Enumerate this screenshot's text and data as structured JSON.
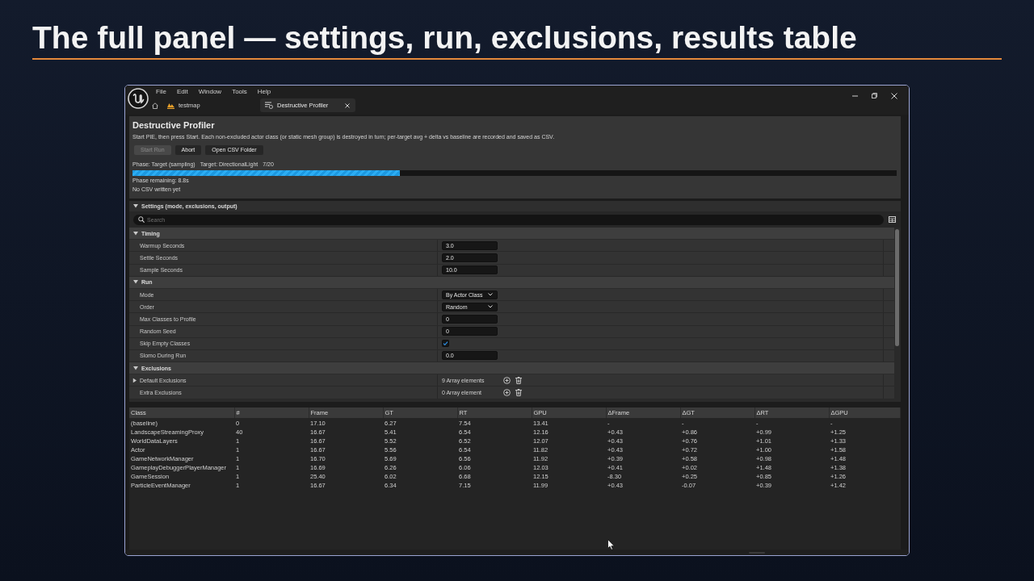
{
  "slide": {
    "title": "The full panel — settings, run, exclusions, results table"
  },
  "window": {
    "menu": [
      "File",
      "Edit",
      "Window",
      "Tools",
      "Help"
    ],
    "level": {
      "label": "testmap"
    },
    "tabs": [
      {
        "label": "Destructive Profiler",
        "selected": true
      }
    ]
  },
  "profiler": {
    "title": "Destructive Profiler",
    "description": "Start PIE, then press Start. Each non-excluded actor class (or static mesh group) is destroyed in turn; per-target avg + delta vs baseline are recorded and saved as CSV.",
    "buttons": [
      {
        "label": "Start Run",
        "disabled": true
      },
      {
        "label": "Abort",
        "disabled": false
      },
      {
        "label": "Open CSV Folder",
        "disabled": false
      }
    ],
    "status": {
      "phase": "Phase: Target (sampling)",
      "target": "Target: DirectionalLight",
      "count": "7/20"
    },
    "progress": {
      "level": 0.35
    },
    "remaining": "Phase remaining: 8.8s",
    "csv_status": "No CSV written yet"
  },
  "settings": {
    "title": "Settings (mode, exclusions, output)",
    "expanded": true,
    "search": {
      "placeholder": "Search"
    },
    "categories": [
      {
        "name": "Timing",
        "expanded": true,
        "properties": [
          {
            "label": "Warmup Seconds",
            "kind": "number",
            "value": "3.0"
          },
          {
            "label": "Settle Seconds",
            "kind": "number",
            "value": "2.0"
          },
          {
            "label": "Sample Seconds",
            "kind": "number",
            "value": "10.0"
          }
        ]
      },
      {
        "name": "Run",
        "expanded": true,
        "properties": [
          {
            "label": "Mode",
            "kind": "dropdown",
            "value": "By Actor Class"
          },
          {
            "label": "Order",
            "kind": "dropdown",
            "value": "Random"
          },
          {
            "label": "Max Classes to Profile",
            "kind": "number",
            "value": "0"
          },
          {
            "label": "Random Seed",
            "kind": "number",
            "value": "0"
          },
          {
            "label": "Skip Empty Classes",
            "kind": "checkbox",
            "checked": true
          },
          {
            "label": "Slomo During Run",
            "kind": "number",
            "value": "0.0"
          }
        ]
      },
      {
        "name": "Exclusions",
        "expanded": true,
        "properties": [
          {
            "label": "Default Exclusions",
            "kind": "array",
            "value": "9 Array elements",
            "expanded": false
          },
          {
            "label": "Extra Exclusions",
            "kind": "array",
            "value": "0 Array element"
          }
        ]
      }
    ]
  },
  "results": {
    "columns": [
      "Class",
      "#",
      "Frame",
      "GT",
      "RT",
      "GPU",
      "ΔFrame",
      "ΔGT",
      "ΔRT",
      "ΔGPU"
    ],
    "rows": [
      [
        "(baseline)",
        "0",
        "17.10",
        "6.27",
        "7.54",
        "13.41",
        "-",
        "-",
        "-",
        "-"
      ],
      [
        "LandscapeStreamingProxy",
        "40",
        "16.67",
        "5.41",
        "6.54",
        "12.16",
        "+0.43",
        "+0.86",
        "+0.99",
        "+1.25"
      ],
      [
        "WorldDataLayers",
        "1",
        "16.67",
        "5.52",
        "6.52",
        "12.07",
        "+0.43",
        "+0.76",
        "+1.01",
        "+1.33"
      ],
      [
        "Actor",
        "1",
        "16.67",
        "5.56",
        "6.54",
        "11.82",
        "+0.43",
        "+0.72",
        "+1.00",
        "+1.58"
      ],
      [
        "GameNetworkManager",
        "1",
        "16.70",
        "5.69",
        "6.56",
        "11.92",
        "+0.39",
        "+0.58",
        "+0.98",
        "+1.48"
      ],
      [
        "GameplayDebuggerPlayerManager",
        "1",
        "16.69",
        "6.26",
        "6.06",
        "12.03",
        "+0.41",
        "+0.02",
        "+1.48",
        "+1.38"
      ],
      [
        "GameSession",
        "1",
        "25.40",
        "6.02",
        "6.68",
        "12.15",
        "-8.30",
        "+0.25",
        "+0.85",
        "+1.26"
      ],
      [
        "ParticleEventManager",
        "1",
        "16.67",
        "6.34",
        "7.15",
        "11.99",
        "+0.43",
        "-0.07",
        "+0.39",
        "+1.42"
      ]
    ]
  }
}
